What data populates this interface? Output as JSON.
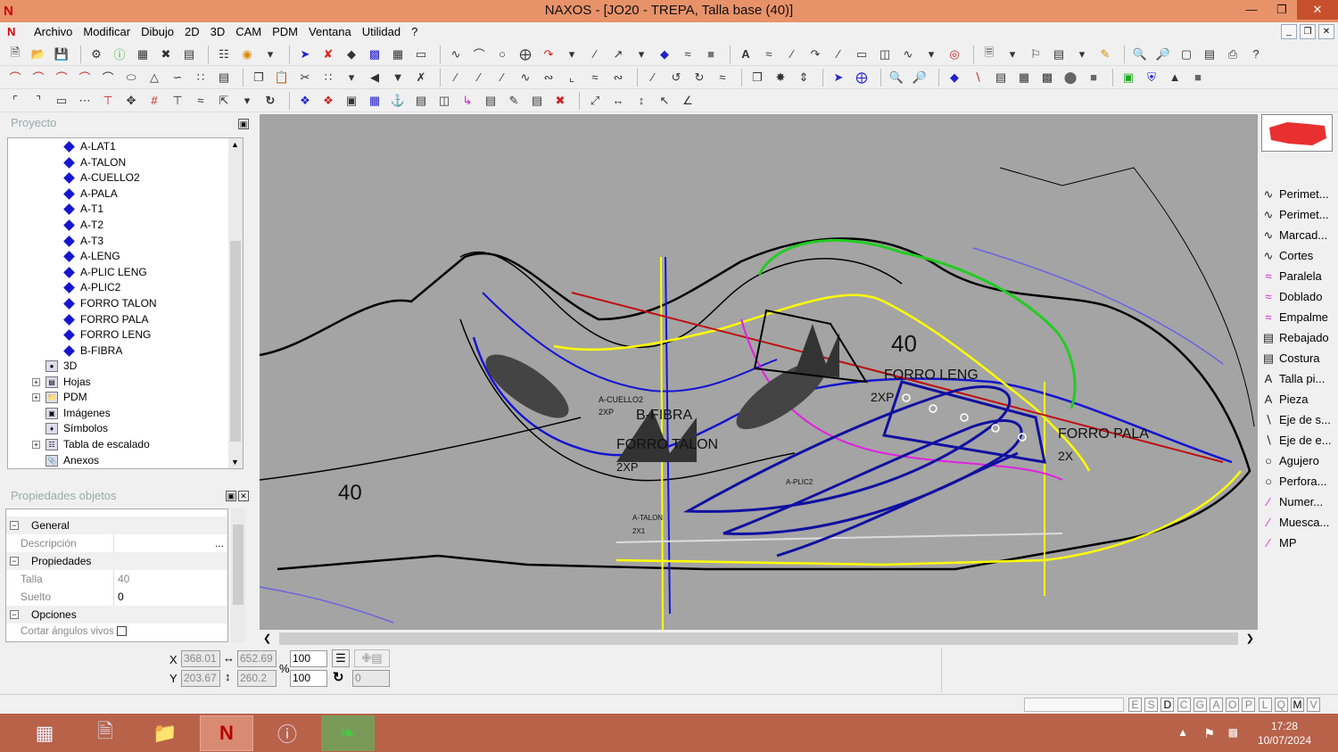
{
  "window": {
    "title": "NAXOS - [JO20 - TREPA, Talla base (40)]"
  },
  "menu": [
    "Archivo",
    "Modificar",
    "Dibujo",
    "2D",
    "3D",
    "CAM",
    "PDM",
    "Ventana",
    "Utilidad",
    "?"
  ],
  "project_panel": {
    "title": "Proyecto",
    "pieces": [
      "A-LAT1",
      "A-TALON",
      "A-CUELLO2",
      "A-PALA",
      "A-T1",
      "A-T2",
      "A-T3",
      "A-LENG",
      "A-PLIC LENG",
      "A-PLIC2",
      "FORRO TALON",
      "FORRO PALA",
      "FORRO LENG",
      "B-FIBRA"
    ],
    "nodes": [
      "3D",
      "Hojas",
      "PDM",
      "Imágenes",
      "Símbolos",
      "Tabla de escalado",
      "Anexos"
    ]
  },
  "properties_panel": {
    "title": "Propiedades objetos",
    "sections": {
      "general": "General",
      "propiedades": "Propiedades",
      "opciones": "Opciones"
    },
    "rows": {
      "descripcion_label": "Descripción",
      "descripcion_button": "...",
      "talla_label": "Talla",
      "talla_value": "40",
      "suelto_label": "Suelto",
      "suelto_value": "0",
      "cortar_label": "Cortar ángulos vivos"
    }
  },
  "canvas_labels": {
    "size_big": "40",
    "size_mid": "40",
    "pieces": [
      "A-CUELLO2",
      "2XP",
      "B-FIBRA",
      "FORRO TALON",
      "2XP",
      "A-TALON",
      "2X1",
      "FORRO LENG",
      "2XP",
      "FORRO PALA",
      "2X",
      "A-PLIC2"
    ]
  },
  "palette": [
    "Perimet...",
    "Perimet...",
    "Marcad...",
    "Cortes",
    "Paralela",
    "Doblado",
    "Empalme",
    "Rebajado",
    "Costura",
    "Talla pi...",
    "Pieza",
    "Eje de s...",
    "Eje de e...",
    "Agujero",
    "Perfora...",
    "Numer...",
    "Muesca...",
    "MP"
  ],
  "palette_icons": [
    "curve-icon",
    "curve-icon",
    "curve-icon",
    "curve-icon",
    "double-curve-icon",
    "double-curve-icon",
    "double-curve-icon",
    "book-icon",
    "book-icon",
    "letter-a-icon",
    "letter-a-icon",
    "axis-icon",
    "axis-icon",
    "circle-icon",
    "circle-icon",
    "pen-icon",
    "pen-icon",
    "pen-icon"
  ],
  "coords": {
    "x_label": "X",
    "y_label": "Y",
    "x_value": "368.01",
    "y_value": "203.67",
    "width_value": "652.69",
    "height_value": "260.2",
    "percent": "%",
    "scale_x": "100",
    "scale_y": "100",
    "rotation": "0"
  },
  "status_flags": [
    "E",
    "S",
    "D",
    "C",
    "G",
    "A",
    "O",
    "P",
    "L",
    "Q",
    "M",
    "V"
  ],
  "status_flags_on": [
    "D",
    "M"
  ],
  "taskbar": {
    "time": "17:28",
    "date": "10/07/2024"
  },
  "colors": {
    "titlebar": "#e8926a",
    "canvas": "#a4a4a4",
    "taskbar": "#b8624a",
    "accent_blue": "#1515d0"
  }
}
